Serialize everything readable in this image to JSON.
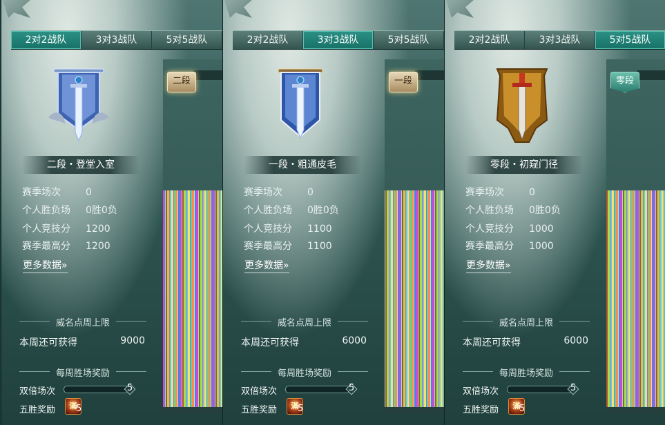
{
  "tabs": [
    "2对2战队",
    "3对3战队",
    "5对5战队"
  ],
  "more_link": "更多数据",
  "more_arrow": "»",
  "section_weekly_limit": "威名点周上限",
  "weekly_obtainable_label": "本周还可获得",
  "section_weekly_wins": "每周胜场奖励",
  "double_label": "双倍场次",
  "five_win_label": "五胜奖励",
  "stat_labels": {
    "season_games": "赛季场次",
    "personal_record": "个人胜负场",
    "personal_score": "个人竞技分",
    "season_best": "赛季最高分"
  },
  "icons": {
    "banner_emblem": "sword-banner-icon",
    "reward": "reward-chest-icon"
  },
  "colors": {
    "tab_active": "#177167",
    "panel_bg": "#2f5753",
    "gold_accent": "#d98f3b"
  },
  "panels": [
    {
      "active_tab_index": 0,
      "rank_title": "二段・登堂入室",
      "side_badge": "二段",
      "emblem_style": "silver-blue",
      "season_games": "0",
      "personal_record": "0胜0负",
      "personal_score": "1200",
      "season_best": "1200",
      "weekly_obtainable": "9000",
      "double_count": "5",
      "double_progress_fraction": 0.0,
      "reward_icon_text": "滿",
      "five_win_reward_count": "5"
    },
    {
      "active_tab_index": 1,
      "rank_title": "一段・粗通皮毛",
      "side_badge": "一段",
      "emblem_style": "blue",
      "season_games": "0",
      "personal_record": "0胜0负",
      "personal_score": "1100",
      "season_best": "1100",
      "weekly_obtainable": "6000",
      "double_count": "5",
      "double_progress_fraction": 0.0,
      "reward_icon_text": "滿",
      "five_win_reward_count": "5"
    },
    {
      "active_tab_index": 2,
      "rank_title": "零段・初窥门径",
      "side_badge": "零段",
      "emblem_style": "bronze",
      "season_games": "0",
      "personal_record": "0胜0负",
      "personal_score": "1000",
      "season_best": "1000",
      "weekly_obtainable": "6000",
      "double_count": "5",
      "double_progress_fraction": 0.0,
      "reward_icon_text": "滿",
      "five_win_reward_count": "5"
    }
  ]
}
